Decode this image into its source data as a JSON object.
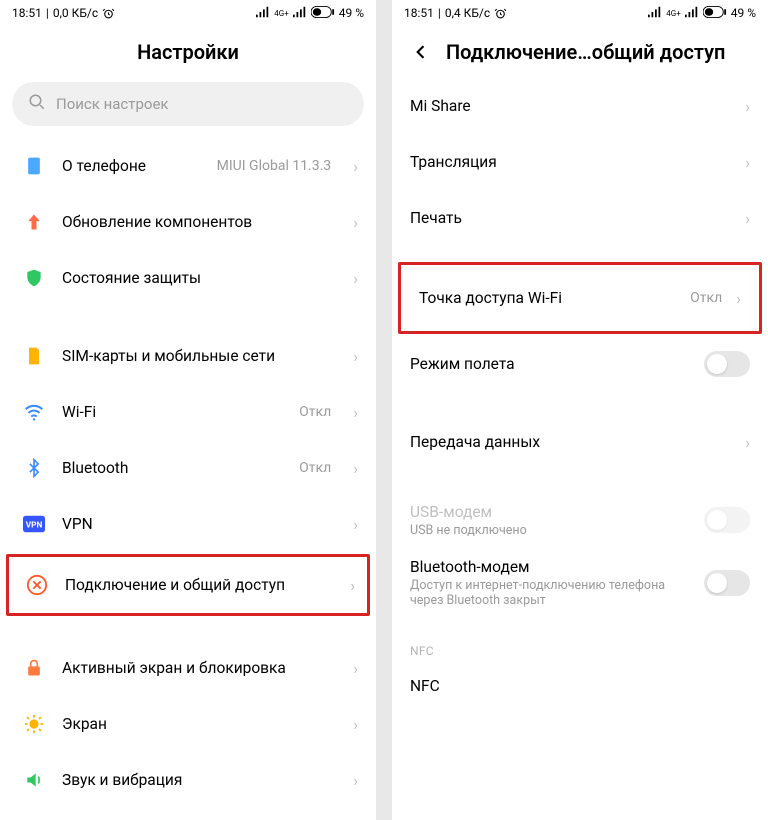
{
  "status": {
    "time": "18:51",
    "speed_left": "0,0 КБ/с",
    "speed_right": "0,4 КБ/с",
    "battery": "49 %"
  },
  "left": {
    "title": "Настройки",
    "search_placeholder": "Поиск настроек",
    "items": {
      "about": {
        "label": "О телефоне",
        "value": "MIUI Global 11.3.3"
      },
      "update": {
        "label": "Обновление компонентов"
      },
      "security": {
        "label": "Состояние защиты"
      },
      "sim": {
        "label": "SIM-карты и мобильные сети"
      },
      "wifi": {
        "label": "Wi-Fi",
        "value": "Откл"
      },
      "bt": {
        "label": "Bluetooth",
        "value": "Откл"
      },
      "vpn": {
        "label": "VPN"
      },
      "connection": {
        "label": "Подключение и общий доступ"
      },
      "lock": {
        "label": "Активный экран и блокировка"
      },
      "display": {
        "label": "Экран"
      },
      "sound": {
        "label": "Звук и вибрация"
      }
    }
  },
  "right": {
    "title": "Подключение…общий доступ",
    "items": {
      "mishare": {
        "label": "Mi Share"
      },
      "cast": {
        "label": "Трансляция"
      },
      "print": {
        "label": "Печать"
      },
      "hotspot": {
        "label": "Точка доступа Wi-Fi",
        "value": "Откл"
      },
      "airplane": {
        "label": "Режим полета"
      },
      "data": {
        "label": "Передача данных"
      },
      "usb": {
        "label": "USB-модем",
        "sub": "USB не подключено"
      },
      "btmodem": {
        "label": "Bluetooth-модем",
        "sub": "Доступ к интернет-подключению телефона через Bluetooth закрыт"
      },
      "nfc_header": "NFC",
      "nfc": {
        "label": "NFC"
      }
    }
  }
}
